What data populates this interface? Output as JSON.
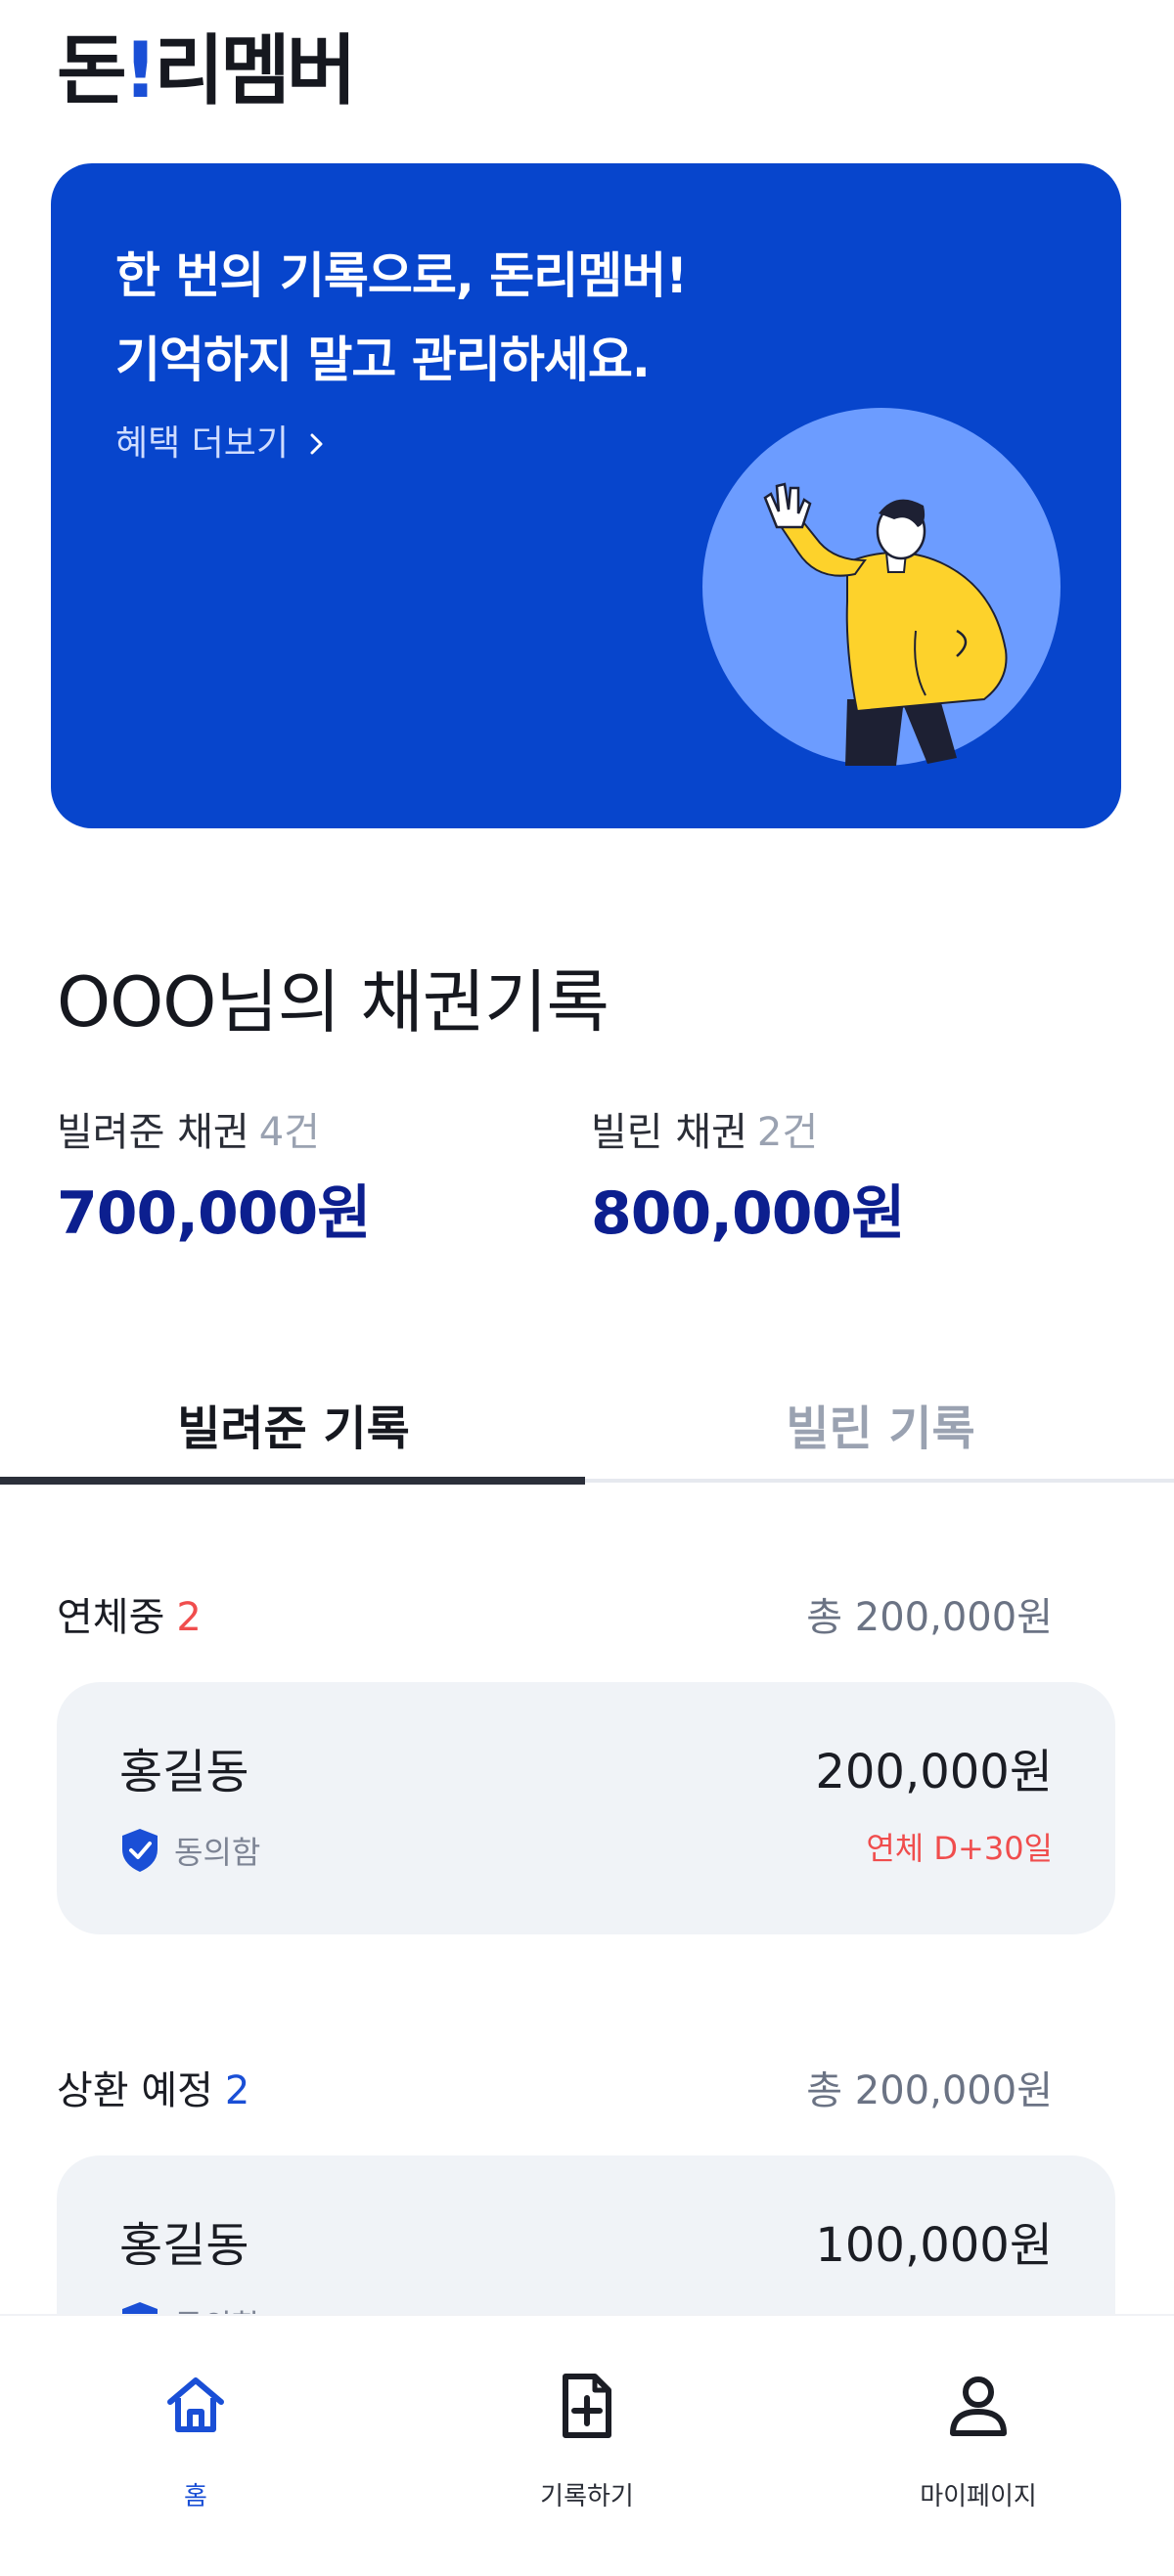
{
  "header": {
    "logo_left": "돈",
    "logo_bang": "!",
    "logo_right": "리멤버"
  },
  "banner": {
    "line1": "한 번의 기록으로, 돈리멤버!",
    "line2": "기억하지 말고 관리하세요.",
    "link_label": "혜택 더보기",
    "bg_color": "#0745cc"
  },
  "summary": {
    "title": "OOO님의 채권기록",
    "lent": {
      "label": "빌려준 채권",
      "count": "4건",
      "amount": "700,000원"
    },
    "borrowed": {
      "label": "빌린 채권",
      "count": "2건",
      "amount": "800,000원"
    }
  },
  "tabs": [
    {
      "label": "빌려준 기록",
      "active": true
    },
    {
      "label": "빌린 기록",
      "active": false
    }
  ],
  "groups": {
    "overdue": {
      "name": "연체중",
      "count": "2",
      "total": "총 200,000원",
      "card": {
        "name": "홍길동",
        "amount": "200,000원",
        "agree": "동의함",
        "status": "연체 D+30일"
      }
    },
    "upcoming": {
      "name": "상환 예정",
      "count": "2",
      "total": "총 200,000원",
      "card": {
        "name": "홍길동",
        "amount": "100,000원",
        "agree": "동의함"
      }
    }
  },
  "nav": [
    {
      "label": "홈",
      "icon": "home-icon",
      "active": true
    },
    {
      "label": "기록하기",
      "icon": "add-file-icon",
      "active": false
    },
    {
      "label": "마이페이지",
      "icon": "user-icon",
      "active": false
    }
  ],
  "colors": {
    "accent": "#1a4fd6",
    "amount": "#0c1f8f",
    "danger": "#f04d4d"
  }
}
